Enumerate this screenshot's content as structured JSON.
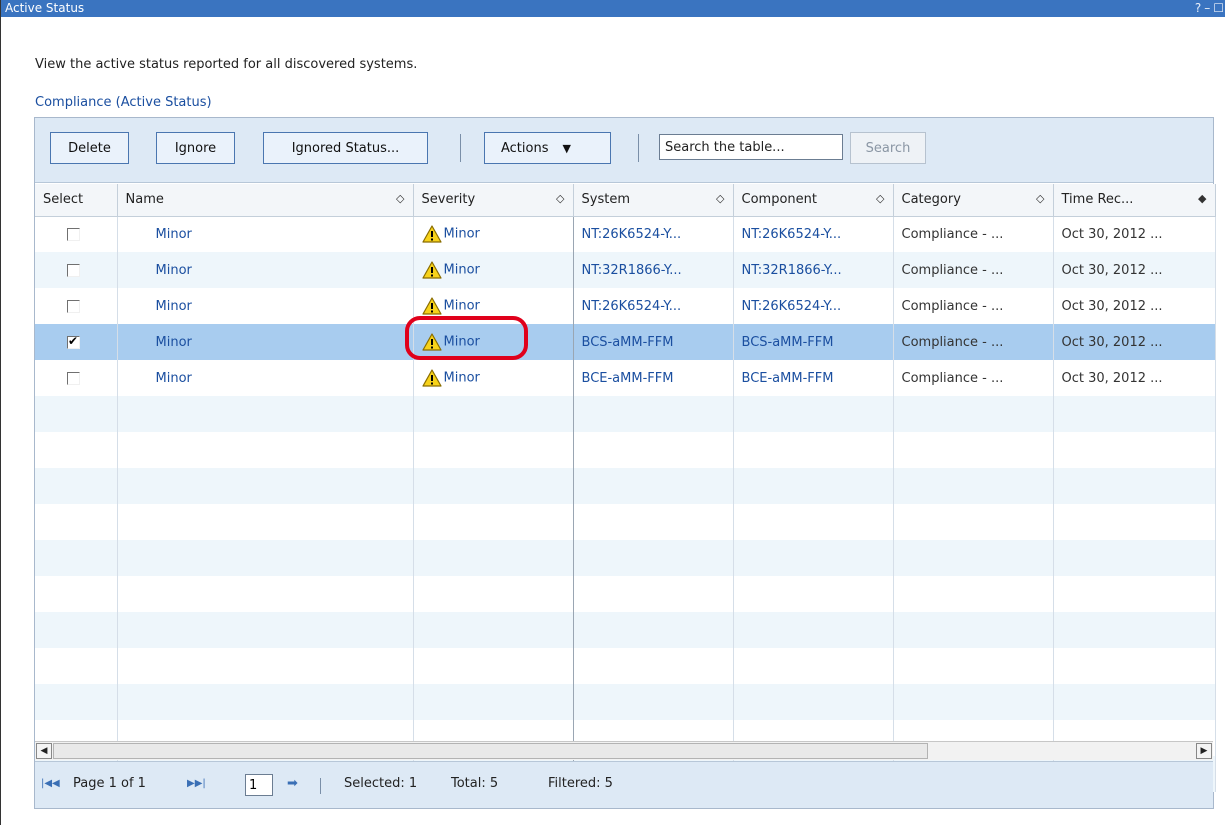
{
  "window": {
    "title": "Active Status",
    "controls": [
      "?",
      "–",
      "☐"
    ]
  },
  "intro_text": "View the active status reported for all discovered systems.",
  "section_link": "Compliance (Active Status)",
  "toolbar": {
    "delete_label": "Delete",
    "ignore_label": "Ignore",
    "ignored_status_label": "Ignored Status...",
    "actions_label": "Actions",
    "search_value": "Search the table...",
    "search_button": "Search"
  },
  "columns": [
    "Select",
    "Name",
    "Severity",
    "System",
    "Component",
    "Category",
    "Time Rec..."
  ],
  "rows": [
    {
      "selected": false,
      "name": "Minor",
      "severity": "Minor",
      "system": "NT:26K6524-Y...",
      "component": "NT:26K6524-Y...",
      "category": "Compliance - ...",
      "time": "Oct 30, 2012 ..."
    },
    {
      "selected": false,
      "name": "Minor",
      "severity": "Minor",
      "system": "NT:32R1866-Y...",
      "component": "NT:32R1866-Y...",
      "category": "Compliance - ...",
      "time": "Oct 30, 2012 ..."
    },
    {
      "selected": false,
      "name": "Minor",
      "severity": "Minor",
      "system": "NT:26K6524-Y...",
      "component": "NT:26K6524-Y...",
      "category": "Compliance - ...",
      "time": "Oct 30, 2012 ..."
    },
    {
      "selected": true,
      "name": "Minor",
      "severity": "Minor",
      "system": "BCS-aMM-FFM",
      "component": "BCS-aMM-FFM",
      "category": "Compliance - ...",
      "time": "Oct 30, 2012 ..."
    },
    {
      "selected": false,
      "name": "Minor",
      "severity": "Minor",
      "system": "BCE-aMM-FFM",
      "component": "BCE-aMM-FFM",
      "category": "Compliance - ...",
      "time": "Oct 30, 2012 ..."
    }
  ],
  "footer": {
    "page_text": "Page 1 of 1",
    "page_input": "1",
    "selected": "Selected: 1",
    "total": "Total: 5",
    "filtered": "Filtered: 5"
  },
  "colors": {
    "titlebar": "#3a74c0",
    "toolbar_bg": "#dde9f5",
    "link": "#1b4fa0",
    "selected_row": "#a8ccef",
    "alt_row": "#eef6fb",
    "highlight": "#e0001b"
  },
  "icons": {
    "severity": "warning-triangle-icon",
    "sort": "sort-arrows-icon"
  }
}
